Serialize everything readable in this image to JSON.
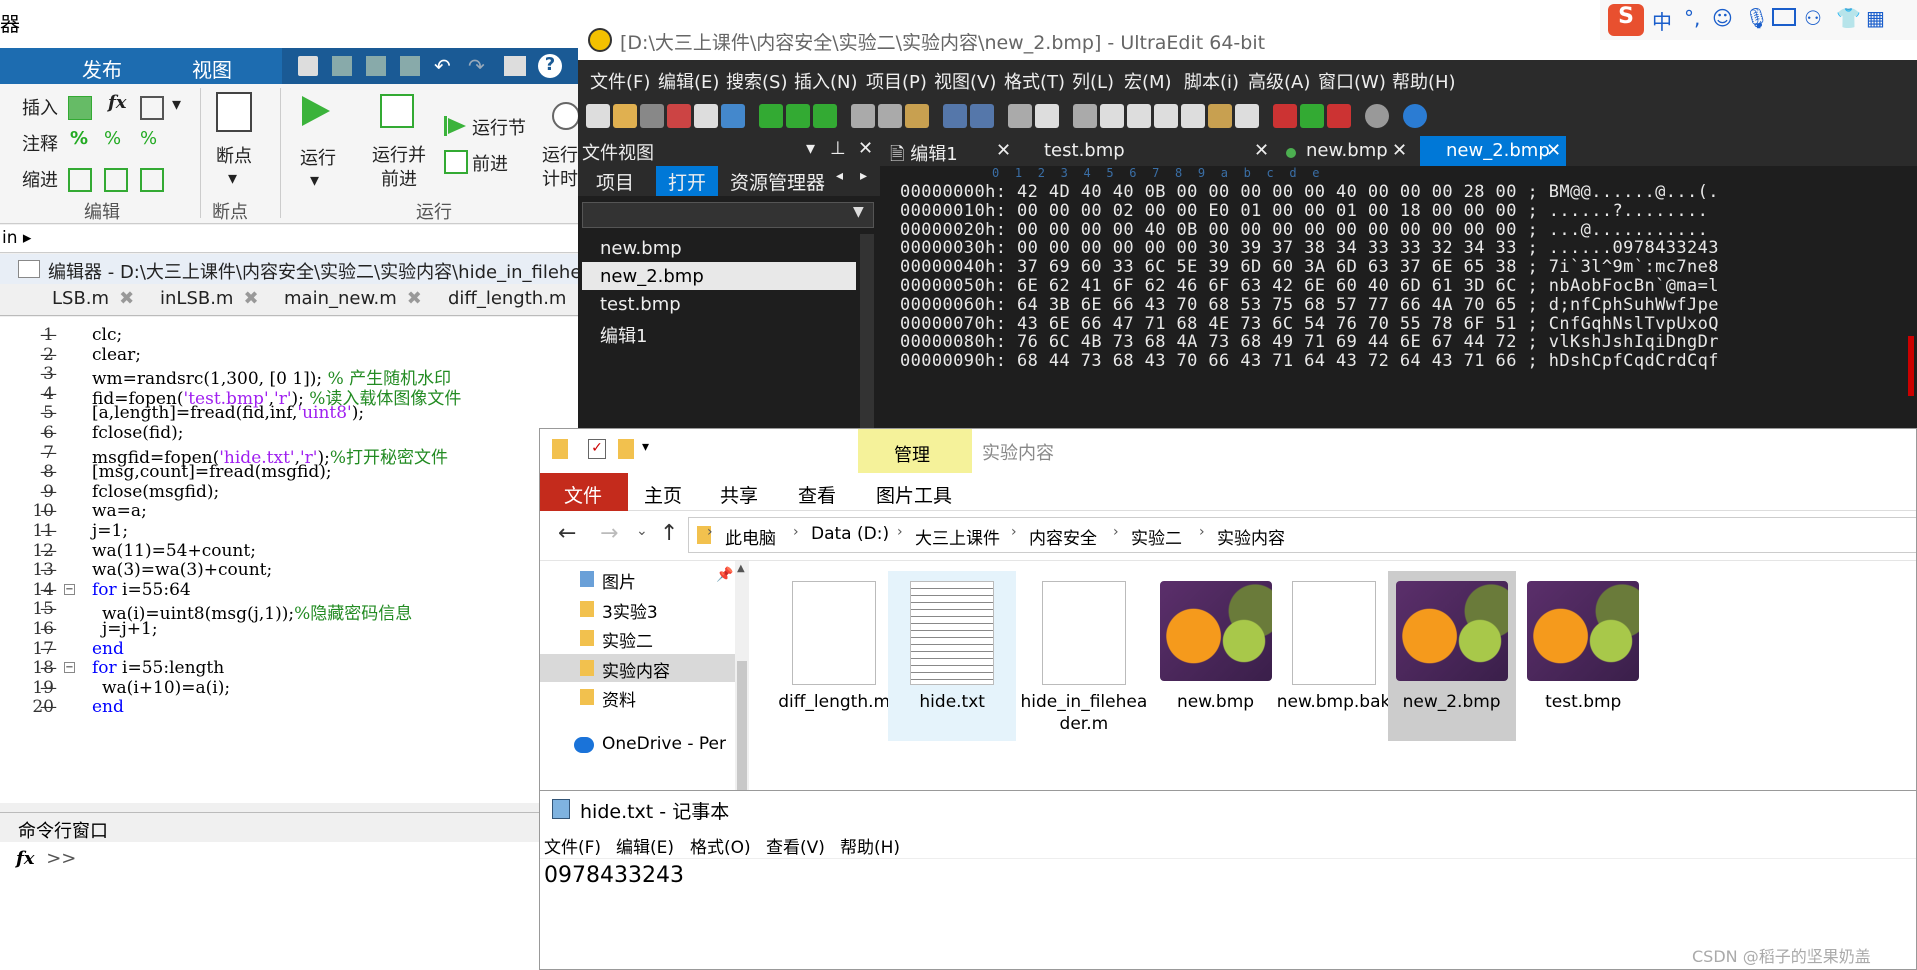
{
  "matlab": {
    "top_partial_label": "器",
    "tabs": [
      "发布",
      "视图"
    ],
    "ribbon": {
      "insert": "插入",
      "comment": "注释",
      "indent": "缩进",
      "fx": "fx",
      "breakpoints": "断点",
      "run": "运行",
      "run_and_advance": "运行并\n前进",
      "run_section": "运行节",
      "advance": "前进",
      "run_and_time": "运行\n计时",
      "group_edit": "编辑",
      "group_breakpoints": "断点",
      "group_run": "运行"
    },
    "path": "in ▸",
    "editor_title": "编辑器 - D:\\大三上课件\\内容安全\\实验二\\实验内容\\hide_in_filehe",
    "file_tabs": [
      "LSB.m",
      "inLSB.m",
      "main_new.m",
      "diff_length.m"
    ],
    "code_lines": [
      {
        "n": "1",
        "code": "clc;"
      },
      {
        "n": "2",
        "code": "clear;"
      },
      {
        "n": "3",
        "code": "wm=randsrc(1,300, [0 1]); % 产生随机水印"
      },
      {
        "n": "4",
        "code": "fid=fopen('test.bmp','r'); %读入载体图像文件"
      },
      {
        "n": "5",
        "code": "[a,length]=fread(fid,inf,'uint8');"
      },
      {
        "n": "6",
        "code": "fclose(fid);"
      },
      {
        "n": "7",
        "code": "msgfid=fopen('hide.txt','r');%打开秘密文件"
      },
      {
        "n": "8",
        "code": "[msg,count]=fread(msgfid);"
      },
      {
        "n": "9",
        "code": "fclose(msgfid);"
      },
      {
        "n": "10",
        "code": "wa=a;"
      },
      {
        "n": "11",
        "code": "j=1;"
      },
      {
        "n": "12",
        "code": "wa(11)=54+count;"
      },
      {
        "n": "13",
        "code": "wa(3)=wa(3)+count;"
      },
      {
        "n": "14",
        "code": "for i=55:64"
      },
      {
        "n": "15",
        "code": "wa(i)=uint8(msg(j,1));%隐藏密码信息"
      },
      {
        "n": "16",
        "code": "j=j+1;"
      },
      {
        "n": "17",
        "code": "end"
      },
      {
        "n": "18",
        "code": "for i=55:length"
      },
      {
        "n": "19",
        "code": "wa(i+10)=a(i);"
      },
      {
        "n": "20",
        "code": "end"
      }
    ],
    "command_window_title": "命令行窗口",
    "command_prompt": ">>"
  },
  "ultraedit": {
    "title": "[D:\\大三上课件\\内容安全\\实验二\\实验内容\\new_2.bmp] - UltraEdit 64-bit",
    "menu": [
      "文件(F)",
      "编辑(E)",
      "搜索(S)",
      "插入(N)",
      "项目(P)",
      "视图(V)",
      "格式(T)",
      "列(L)",
      "宏(M)",
      "脚本(i)",
      "高级(A)",
      "窗口(W)",
      "帮助(H)"
    ],
    "fileview_title": "文件视图",
    "fileview_tabs": [
      "项目",
      "打开",
      "资源管理器"
    ],
    "open_files": [
      "new.bmp",
      "new_2.bmp",
      "test.bmp",
      "编辑1"
    ],
    "doc_tabs": [
      "编辑1",
      "test.bmp",
      "new.bmp",
      "new_2.bmp"
    ],
    "hex_ruler": "0  1  2  3  4  5  6  7  8  9  a  b  c  d  e",
    "hex_rows": [
      {
        "addr": "00000000h:",
        "bytes": "42 4D 40 40 0B 00 00 00 00 00 40 00 00 00 28 00",
        "ascii": "BM@@......@...(."
      },
      {
        "addr": "00000010h:",
        "bytes": "00 00 00 02 00 00 E0 01 00 00 01 00 18 00 00 00",
        "ascii": "......?........"
      },
      {
        "addr": "00000020h:",
        "bytes": "00 00 00 00 40 0B 00 00 00 00 00 00 00 00 00 00",
        "ascii": "...@..........."
      },
      {
        "addr": "00000030h:",
        "bytes": "00 00 00 00 00 00 30 39 37 38 34 33 33 32 34 33",
        "ascii": "......0978433243"
      },
      {
        "addr": "00000040h:",
        "bytes": "37 69 60 33 6C 5E 39 6D 60 3A 6D 63 37 6E 65 38",
        "ascii": "7i`3l^9m`:mc7ne8"
      },
      {
        "addr": "00000050h:",
        "bytes": "6E 62 41 6F 62 46 6F 63 42 6E 60 40 6D 61 3D 6C",
        "ascii": "nbAobFocBn`@ma=l"
      },
      {
        "addr": "00000060h:",
        "bytes": "64 3B 6E 66 43 70 68 53 75 68 57 77 66 4A 70 65",
        "ascii": "d;nfCphSuhWwfJpe"
      },
      {
        "addr": "00000070h:",
        "bytes": "43 6E 66 47 71 68 4E 73 6C 54 76 70 55 78 6F 51",
        "ascii": "CnfGqhNslTvpUxoQ"
      },
      {
        "addr": "00000080h:",
        "bytes": "76 6C 4B 73 68 4A 73 68 49 71 69 44 6E 67 44 72",
        "ascii": "vlKshJshIqiDngDr"
      },
      {
        "addr": "00000090h:",
        "bytes": "68 44 73 68 43 70 66 43 71 64 43 72 64 43 71 66",
        "ascii": "hDshCpfCqdCrdCqf"
      }
    ]
  },
  "explorer": {
    "manage_tab": "管理",
    "title": "实验内容",
    "ribbon_tabs": [
      "文件",
      "主页",
      "共享",
      "查看"
    ],
    "picture_tools": "图片工具",
    "breadcrumb": [
      "此电脑",
      "Data (D:)",
      "大三上课件",
      "内容安全",
      "实验二",
      "实验内容"
    ],
    "nav": [
      "图片",
      "3实验3",
      "实验二",
      "实验内容",
      "资料",
      "OneDrive - Per"
    ],
    "files": [
      {
        "name": "diff_length.m",
        "kind": "blank"
      },
      {
        "name": "hide.txt",
        "kind": "text"
      },
      {
        "name": "hide_in_filehea\nder.m",
        "kind": "blank"
      },
      {
        "name": "new.bmp",
        "kind": "image"
      },
      {
        "name": "new.bmp.bak",
        "kind": "blank"
      },
      {
        "name": "new_2.bmp",
        "kind": "image"
      },
      {
        "name": "test.bmp",
        "kind": "image"
      }
    ]
  },
  "notepad": {
    "title": "hide.txt - 记事本",
    "menu": [
      "文件(F)",
      "编辑(E)",
      "格式(O)",
      "查看(V)",
      "帮助(H)"
    ],
    "content": "0978433243"
  },
  "watermark": "CSDN @稻子的坚果奶盖",
  "colors": {
    "matlab_blue": "#1d6cb0",
    "ue_accent": "#0078d7",
    "explorer_red": "#c42b1c",
    "manage_yellow": "#f5f29a"
  }
}
